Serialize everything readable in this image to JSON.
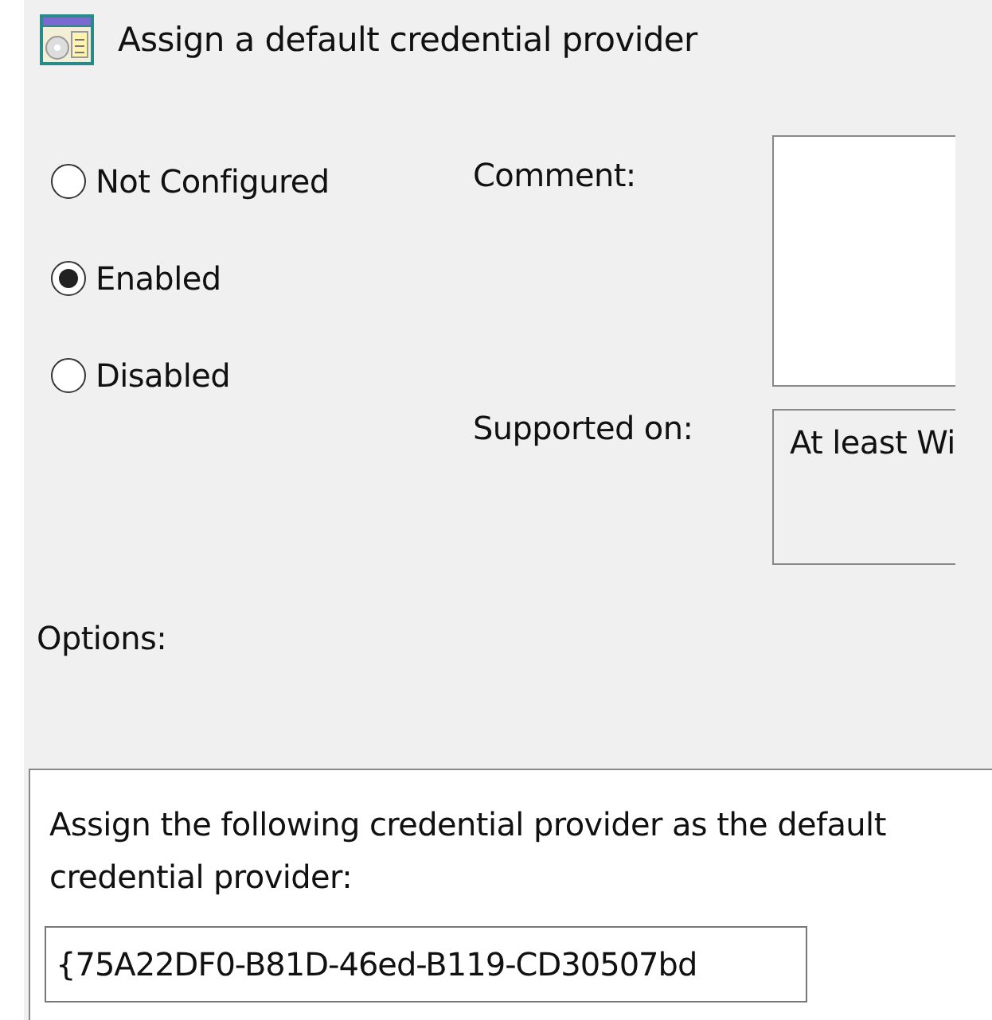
{
  "window": {
    "title": "Assign a default credential provider"
  },
  "state_options": [
    {
      "label": "Not Configured",
      "selected": false
    },
    {
      "label": "Enabled",
      "selected": true
    },
    {
      "label": "Disabled",
      "selected": false
    }
  ],
  "comment": {
    "label": "Comment:"
  },
  "supported_on": {
    "label": "Supported on:",
    "value": "At least Wi"
  },
  "options": {
    "label": "Options:",
    "description": "Assign the following credential provider as the default credential provider:",
    "value": "{75A22DF0-B81D-46ed-B119-CD30507bd"
  }
}
